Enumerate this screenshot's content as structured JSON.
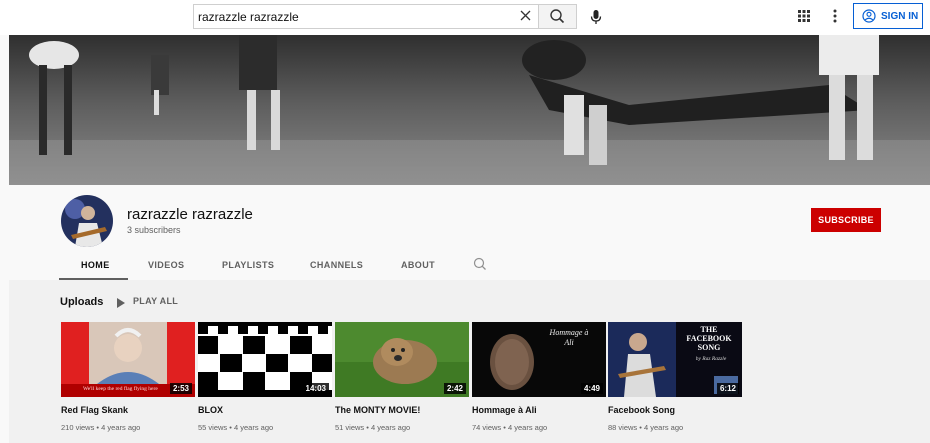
{
  "search": {
    "value": "razrazzle razrazzle"
  },
  "header": {
    "signin_label": "SIGN IN"
  },
  "icons": {
    "clear": "close-icon",
    "search": "search-icon",
    "mic": "microphone-icon",
    "apps": "apps-grid-icon",
    "more": "more-vertical-icon",
    "account": "account-circle-icon",
    "play": "play-icon"
  },
  "colors": {
    "accent": "#065fd4",
    "subscribe": "#cc0000"
  },
  "channel": {
    "name": "razrazzle razrazzle",
    "subscribers": "3 subscribers",
    "subscribe_label": "SUBSCRIBE"
  },
  "tabs": [
    {
      "label": "HOME",
      "active": true
    },
    {
      "label": "VIDEOS"
    },
    {
      "label": "PLAYLISTS"
    },
    {
      "label": "CHANNELS"
    },
    {
      "label": "ABOUT"
    }
  ],
  "uploads": {
    "label": "Uploads",
    "play_all_label": "PLAY ALL",
    "videos": [
      {
        "title": "Red Flag Skank",
        "meta": "210 views • 4 years ago",
        "duration": "2:53",
        "thumb_caption": "We'll keep the red flag flying here"
      },
      {
        "title": "BLOX",
        "meta": "55 views • 4 years ago",
        "duration": "14:03"
      },
      {
        "title": "The MONTY MOVIE!",
        "meta": "51 views • 4 years ago",
        "duration": "2:42"
      },
      {
        "title": "Hommage à Ali",
        "meta": "74 views • 4 years ago",
        "duration": "4:49",
        "thumb_text": "Hommage à Ali"
      },
      {
        "title": "Facebook Song",
        "meta": "88 views • 4 years ago",
        "duration": "6:12",
        "thumb_text": "THE FACEBOOK SONG",
        "thumb_byline": "by Raz Razzle"
      }
    ]
  }
}
